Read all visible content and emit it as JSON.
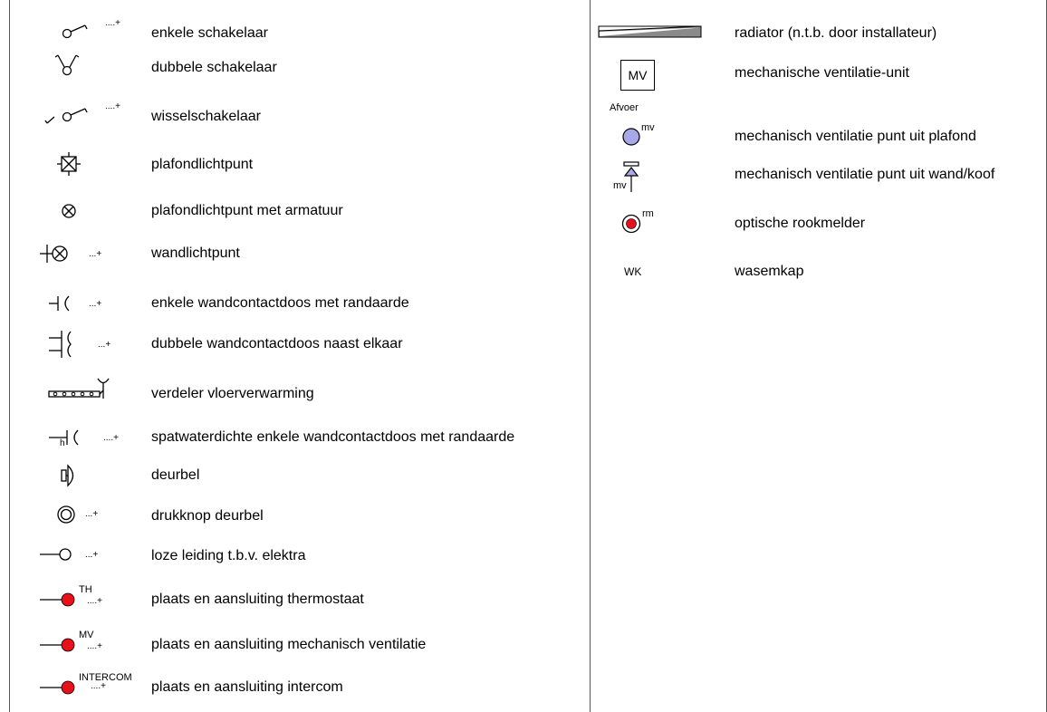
{
  "left_items": [
    {
      "icon": "single-switch-icon",
      "label": "enkele schakelaar",
      "suffix": "....+"
    },
    {
      "icon": "double-switch-icon",
      "label": "dubbele schakelaar"
    },
    {
      "icon": "changeover-switch-icon",
      "label": "wisselschakelaar",
      "suffix": "....+"
    },
    {
      "icon": "ceiling-light-point-icon",
      "label": "plafondlichtpunt"
    },
    {
      "icon": "ceiling-light-fixture-icon",
      "label": "plafondlichtpunt met armatuur"
    },
    {
      "icon": "wall-light-point-icon",
      "label": "wandlichtpunt",
      "suffix": "...+"
    },
    {
      "icon": "single-socket-icon",
      "label": "enkele wandcontactdoos met randaarde",
      "suffix": "...+"
    },
    {
      "icon": "double-socket-icon",
      "label": "dubbele wandcontactdoos naast elkaar",
      "suffix": "...+"
    },
    {
      "icon": "floor-heating-manifold-icon",
      "label": "verdeler vloerverwarming"
    },
    {
      "icon": "splashproof-socket-icon",
      "label": "spatwaterdichte enkele wandcontactdoos met randaarde",
      "suffix": "....+",
      "marker": "h"
    },
    {
      "icon": "doorbell-icon",
      "label": "deurbel"
    },
    {
      "icon": "doorbell-button-icon",
      "label": "drukknop deurbel",
      "suffix": "...+"
    },
    {
      "icon": "empty-conduit-icon",
      "label": "loze leiding t.b.v. elektra",
      "suffix": "...+"
    },
    {
      "icon": "thermostat-connection-icon",
      "label": "plaats en aansluiting thermostaat",
      "sup": "TH",
      "suffix": "....+"
    },
    {
      "icon": "ventilation-connection-icon",
      "label": "plaats en aansluiting mechanisch ventilatie",
      "sup": "MV",
      "suffix": "....+"
    },
    {
      "icon": "intercom-connection-icon",
      "label": "plaats en aansluiting intercom",
      "sup": "INTERCOM",
      "suffix": "....+"
    }
  ],
  "right_items": [
    {
      "icon": "radiator-icon",
      "label": "radiator (n.t.b. door installateur)"
    },
    {
      "icon": "ventilation-unit-icon",
      "label": "mechanische ventilatie-unit",
      "box_text": "MV"
    },
    {
      "icon": "ceiling-vent-point-icon",
      "label": "mechanisch ventilatie punt uit plafond",
      "caption": "Afvoer",
      "sup": "mv"
    },
    {
      "icon": "wall-vent-point-icon",
      "label": "mechanisch ventilatie punt uit wand/koof",
      "sub": "mv"
    },
    {
      "icon": "smoke-detector-icon",
      "label": "optische rookmelder",
      "sup": "rm"
    },
    {
      "icon": "cooker-hood-icon",
      "label": "wasemkap",
      "code": "WK"
    }
  ],
  "colors": {
    "red": "#e8101a",
    "vent_fill": "#a8a8e8",
    "radiator_fill": "#8a8a8a",
    "line": "#000000"
  }
}
